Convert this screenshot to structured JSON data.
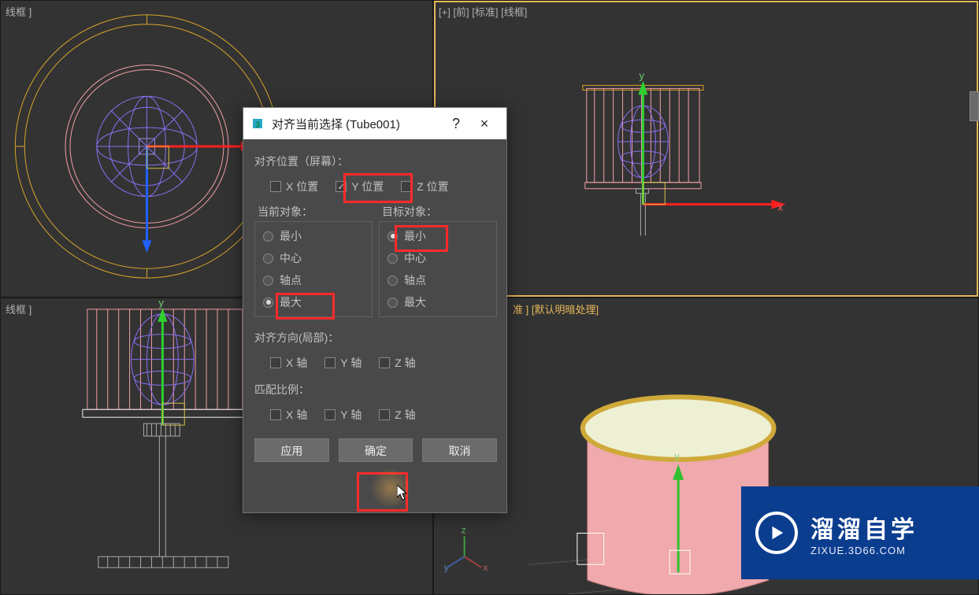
{
  "viewports": {
    "top_left_label": "线框 ]",
    "top_right_label": "[+] [前] [标准] [线框]",
    "bottom_left_label": "线框 ]",
    "bottom_right_label": "准 ] [默认明暗处理]"
  },
  "dialog": {
    "title": "对齐当前选择 (Tube001)",
    "help": "?",
    "close": "×",
    "align_position_label": "对齐位置（屏幕）：",
    "axis": {
      "x": "X 位置",
      "y": "Y 位置",
      "z": "Z 位置",
      "y_checked": true
    },
    "current_obj_label": "当前对象：",
    "target_obj_label": "目标对象：",
    "options": {
      "min": "最小",
      "center": "中心",
      "pivot": "轴点",
      "max": "最大"
    },
    "current_selected": "max",
    "target_selected": "min",
    "align_orientation_label": "对齐方向(局部)：",
    "orient": {
      "x": "X 轴",
      "y": "Y 轴",
      "z": "Z 轴"
    },
    "match_scale_label": "匹配比例：",
    "scale": {
      "x": "X 轴",
      "y": "Y 轴",
      "z": "Z 轴"
    },
    "buttons": {
      "apply": "应用",
      "ok": "确定",
      "cancel": "取消"
    }
  },
  "axis_markers": {
    "x": "x",
    "y": "y",
    "z": "z"
  },
  "watermark": {
    "brand": "溜溜自学",
    "url": "ZIXUE.3D66.COM"
  }
}
